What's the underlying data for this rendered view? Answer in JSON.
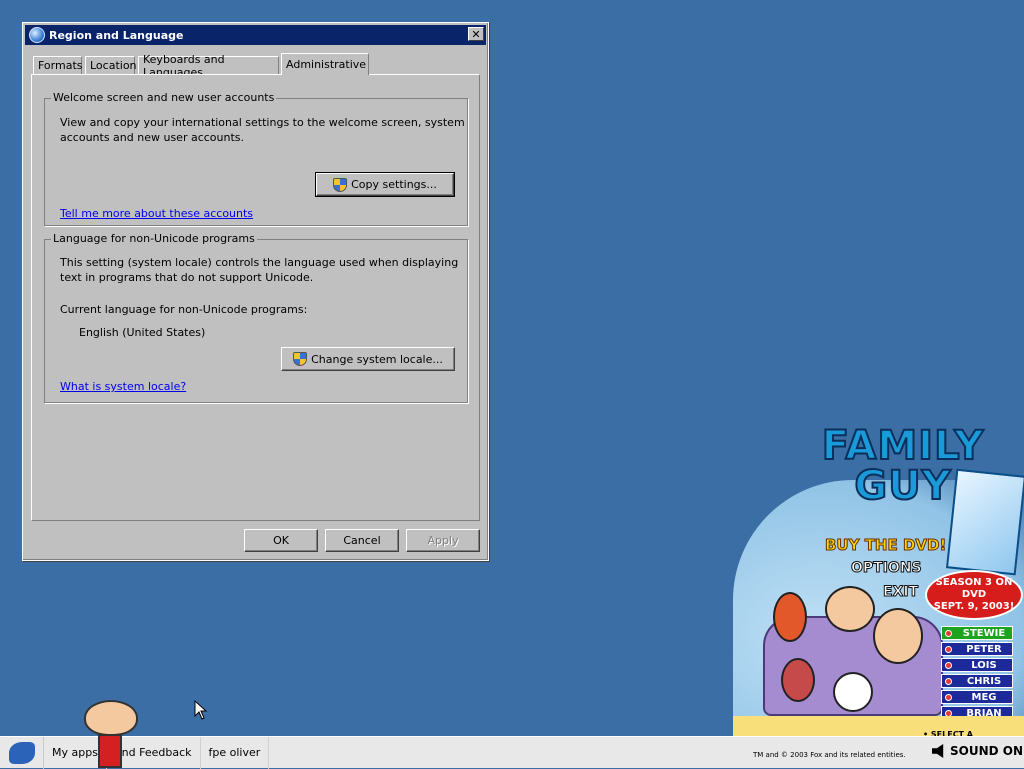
{
  "dialog": {
    "title": "Region and Language",
    "close_label": "✕",
    "tabs": [
      {
        "label": "Formats"
      },
      {
        "label": "Location"
      },
      {
        "label": "Keyboards and Languages"
      },
      {
        "label": "Administrative"
      }
    ],
    "group1": {
      "title": "Welcome screen and new user accounts",
      "description_line1": "View and copy your international settings to the welcome screen, system",
      "description_line2": "accounts and new user accounts.",
      "copy_button": "Copy settings...",
      "link": "Tell me more about these accounts"
    },
    "group2": {
      "title": "Language for non-Unicode programs",
      "description_line1": "This setting (system locale) controls the language used when displaying",
      "description_line2": "text in programs that do not support Unicode.",
      "current_label": "Current language for non-Unicode programs:",
      "current_value": "English (United States)",
      "change_button": "Change system locale...",
      "link": "What is system locale?"
    },
    "buttons": {
      "ok": "OK",
      "cancel": "Cancel",
      "apply": "Apply"
    }
  },
  "family_guy": {
    "logo": "FAMILY GUY",
    "menu": {
      "buy": "BUY THE DVD!",
      "options": "OPTIONS",
      "exit": "EXIT"
    },
    "season_line1": "SEASON 3 ON DVD",
    "season_line2": "SEPT. 9, 2003!",
    "characters": [
      "STEWIE",
      "PETER",
      "LOIS",
      "CHRIS",
      "MEG",
      "BRIAN"
    ],
    "select_hint": "• SELECT A CHARACTER ABOVE",
    "copyright": "TM and © 2003 Fox and its related entities.",
    "sound": "SOUND ON"
  },
  "taskbar": {
    "items": [
      "My apps",
      "and Feedback",
      "fpe oliver"
    ]
  }
}
